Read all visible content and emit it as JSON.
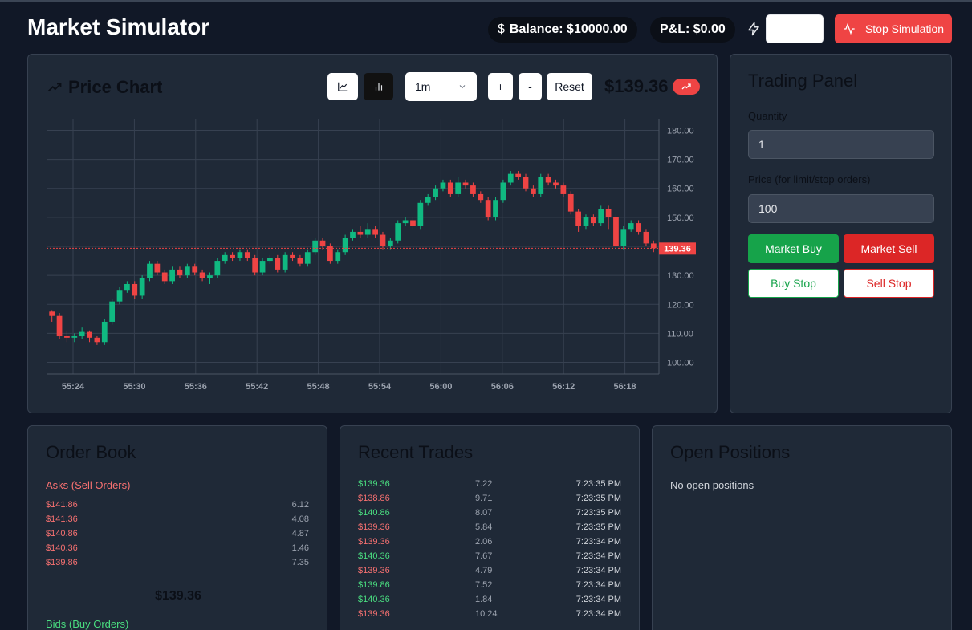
{
  "header": {
    "title": "Market Simulator",
    "balance": "Balance: $10000.00",
    "balance_icon": "$",
    "pnl": "P&L: $0.00",
    "stop_label": "Stop Simulation"
  },
  "colors": {
    "bg": "#111827",
    "card": "#1f2937",
    "up": "#10b981",
    "down": "#ef4444",
    "buy": "#16a34a",
    "sell": "#dc2626"
  },
  "chart_panel": {
    "title": "Price Chart",
    "interval": "1m",
    "zoom_in": "+",
    "zoom_out": "-",
    "reset": "Reset",
    "current_price": "$139.36"
  },
  "chart_data": {
    "type": "candlestick",
    "ylim": [
      96,
      184
    ],
    "yticks": [
      "180.00",
      "170.00",
      "160.00",
      "150.00",
      "140.00",
      "130.00",
      "120.00",
      "110.00",
      "100.00"
    ],
    "ytick_values": [
      180,
      170,
      160,
      150,
      140,
      130,
      120,
      110,
      100
    ],
    "xticks": [
      "55:24",
      "55:30",
      "55:36",
      "55:42",
      "55:48",
      "55:54",
      "56:00",
      "56:06",
      "56:12",
      "56:18"
    ],
    "last_price": 139.36,
    "last_label": "139.36",
    "grid": true,
    "candles": [
      [
        117.5,
        116,
        118,
        114
      ],
      [
        116,
        109,
        117,
        108
      ],
      [
        109,
        108.5,
        111,
        107
      ],
      [
        108.5,
        109,
        110,
        107
      ],
      [
        109,
        110.5,
        112,
        108
      ],
      [
        110.5,
        108.5,
        111,
        107
      ],
      [
        108.5,
        107,
        109,
        106
      ],
      [
        107,
        114,
        115,
        106
      ],
      [
        114,
        121,
        122,
        113
      ],
      [
        121,
        125,
        126,
        120
      ],
      [
        125,
        127,
        128,
        124
      ],
      [
        127,
        123,
        128,
        122
      ],
      [
        123,
        129,
        130,
        122
      ],
      [
        129,
        134,
        135,
        128
      ],
      [
        134,
        131,
        135,
        130
      ],
      [
        131,
        128,
        132,
        127
      ],
      [
        128,
        132,
        133,
        127
      ],
      [
        132,
        130,
        133,
        129
      ],
      [
        130,
        133,
        134,
        129
      ],
      [
        133,
        131,
        134,
        130
      ],
      [
        131,
        129,
        132,
        128
      ],
      [
        129,
        130,
        131,
        127
      ],
      [
        130,
        135,
        136,
        129
      ],
      [
        135,
        137,
        138,
        134
      ],
      [
        137,
        136,
        138,
        135
      ],
      [
        136,
        138,
        139,
        135
      ],
      [
        138,
        136,
        139,
        135
      ],
      [
        136,
        131,
        137,
        130
      ],
      [
        131,
        135,
        136,
        130
      ],
      [
        135,
        136,
        137,
        134
      ],
      [
        136,
        132,
        137,
        131
      ],
      [
        132,
        137,
        138,
        131
      ],
      [
        137,
        136,
        138,
        135
      ],
      [
        136,
        134,
        137,
        133
      ],
      [
        134,
        138,
        139,
        133
      ],
      [
        138,
        142,
        143,
        137
      ],
      [
        142,
        140,
        143,
        139
      ],
      [
        140,
        135,
        141,
        134
      ],
      [
        135,
        138,
        139,
        134
      ],
      [
        138,
        143,
        144,
        137
      ],
      [
        143,
        145,
        146,
        142
      ],
      [
        145,
        144,
        147,
        143
      ],
      [
        144,
        146,
        148,
        143
      ],
      [
        146,
        144,
        147,
        143
      ],
      [
        144,
        140,
        145,
        139
      ],
      [
        140,
        142,
        143,
        139
      ],
      [
        142,
        148,
        149,
        141
      ],
      [
        148,
        149,
        150,
        147
      ],
      [
        149,
        147,
        150,
        146
      ],
      [
        147,
        155,
        156,
        146
      ],
      [
        155,
        157,
        158,
        154
      ],
      [
        157,
        160,
        161,
        156
      ],
      [
        160,
        162,
        163,
        159
      ],
      [
        162,
        158,
        163,
        157
      ],
      [
        158,
        162,
        164,
        157
      ],
      [
        162,
        161,
        163,
        160
      ],
      [
        161,
        158,
        162,
        157
      ],
      [
        158,
        156,
        159,
        155
      ],
      [
        156,
        150,
        157,
        149
      ],
      [
        150,
        156,
        157,
        149
      ],
      [
        156,
        162,
        163,
        155
      ],
      [
        162,
        165,
        166,
        161
      ],
      [
        165,
        164,
        166,
        163
      ],
      [
        164,
        160,
        165,
        159
      ],
      [
        160,
        158,
        161,
        157
      ],
      [
        158,
        164,
        165,
        157
      ],
      [
        164,
        162,
        165,
        161
      ],
      [
        162,
        161,
        163,
        160
      ],
      [
        161,
        158,
        162,
        157
      ],
      [
        158,
        152,
        159,
        151
      ],
      [
        152,
        147,
        153,
        145
      ],
      [
        147,
        150,
        151,
        146
      ],
      [
        150,
        148,
        151,
        147
      ],
      [
        148,
        153,
        154,
        147
      ],
      [
        153,
        150,
        154,
        146
      ],
      [
        150,
        140,
        151,
        139
      ],
      [
        140,
        146,
        147,
        139
      ],
      [
        146,
        148,
        149,
        145
      ],
      [
        148,
        145,
        149,
        144
      ],
      [
        145,
        141,
        146,
        140
      ],
      [
        141,
        139.36,
        142,
        138
      ]
    ]
  },
  "trading_panel": {
    "title": "Trading Panel",
    "quantity_label": "Quantity",
    "quantity_value": "1",
    "price_label": "Price (for limit/stop orders)",
    "price_value": "100",
    "market_buy": "Market Buy",
    "market_sell": "Market Sell",
    "buy_stop": "Buy Stop",
    "sell_stop": "Sell Stop"
  },
  "order_book": {
    "title": "Order Book",
    "asks_label": "Asks (Sell Orders)",
    "asks": [
      {
        "price": "$141.86",
        "qty": "6.12"
      },
      {
        "price": "$141.36",
        "qty": "4.08"
      },
      {
        "price": "$140.86",
        "qty": "4.87"
      },
      {
        "price": "$140.36",
        "qty": "1.46"
      },
      {
        "price": "$139.86",
        "qty": "7.35"
      }
    ],
    "mid_price": "$139.36",
    "bids_label": "Bids (Buy Orders)"
  },
  "recent_trades": {
    "title": "Recent Trades",
    "rows": [
      {
        "price": "$139.36",
        "qty": "7.22",
        "time": "7:23:35 PM",
        "side": "buy"
      },
      {
        "price": "$138.86",
        "qty": "9.71",
        "time": "7:23:35 PM",
        "side": "sell"
      },
      {
        "price": "$140.86",
        "qty": "8.07",
        "time": "7:23:35 PM",
        "side": "buy"
      },
      {
        "price": "$139.36",
        "qty": "5.84",
        "time": "7:23:35 PM",
        "side": "sell"
      },
      {
        "price": "$139.36",
        "qty": "2.06",
        "time": "7:23:34 PM",
        "side": "sell"
      },
      {
        "price": "$140.36",
        "qty": "7.67",
        "time": "7:23:34 PM",
        "side": "buy"
      },
      {
        "price": "$139.36",
        "qty": "4.79",
        "time": "7:23:34 PM",
        "side": "sell"
      },
      {
        "price": "$139.86",
        "qty": "7.52",
        "time": "7:23:34 PM",
        "side": "buy"
      },
      {
        "price": "$140.36",
        "qty": "1.84",
        "time": "7:23:34 PM",
        "side": "buy"
      },
      {
        "price": "$139.36",
        "qty": "10.24",
        "time": "7:23:34 PM",
        "side": "sell"
      }
    ]
  },
  "open_positions": {
    "title": "Open Positions",
    "empty_text": "No open positions"
  }
}
